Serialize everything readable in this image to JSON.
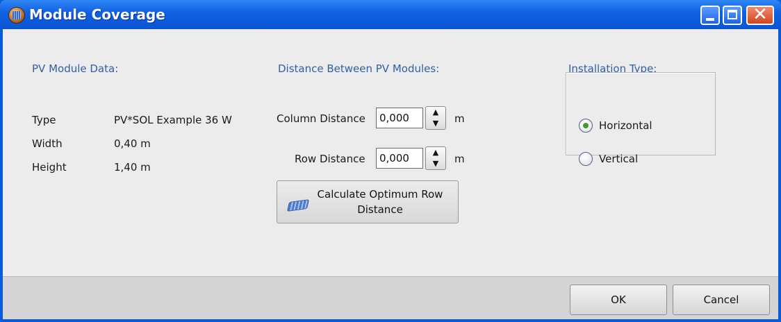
{
  "window": {
    "title": "Module Coverage",
    "controls": [
      "minimize",
      "maximize",
      "close"
    ]
  },
  "module_data": {
    "heading": "PV Module Data:",
    "rows": [
      {
        "label": "Type",
        "value": "PV*SOL Example 36 W"
      },
      {
        "label": "Width",
        "value": "0,40 m"
      },
      {
        "label": "Height",
        "value": "1,40 m"
      }
    ]
  },
  "distance": {
    "heading": "Distance Between PV Modules:",
    "column": {
      "label": "Column Distance",
      "value": "0,000",
      "unit": "m"
    },
    "row": {
      "label": "Row Distance",
      "value": "0,000",
      "unit": "m"
    },
    "calc_button": "Calculate Optimum Row Distance"
  },
  "installation": {
    "heading": "Installation Type:",
    "options": [
      {
        "label": "Horizontal",
        "checked": true
      },
      {
        "label": "Vertical",
        "checked": false
      }
    ]
  },
  "footer": {
    "ok": "OK",
    "cancel": "Cancel"
  },
  "icons": {
    "app": "pvsol-app-icon",
    "calc": "pv-panel-icon",
    "spin_up": "arrow-up-icon",
    "spin_down": "arrow-down-icon"
  },
  "colors": {
    "titlebar": "#0a5bd8",
    "heading_text": "#2f5fa8",
    "radio_checked": "#3e9a2a"
  }
}
